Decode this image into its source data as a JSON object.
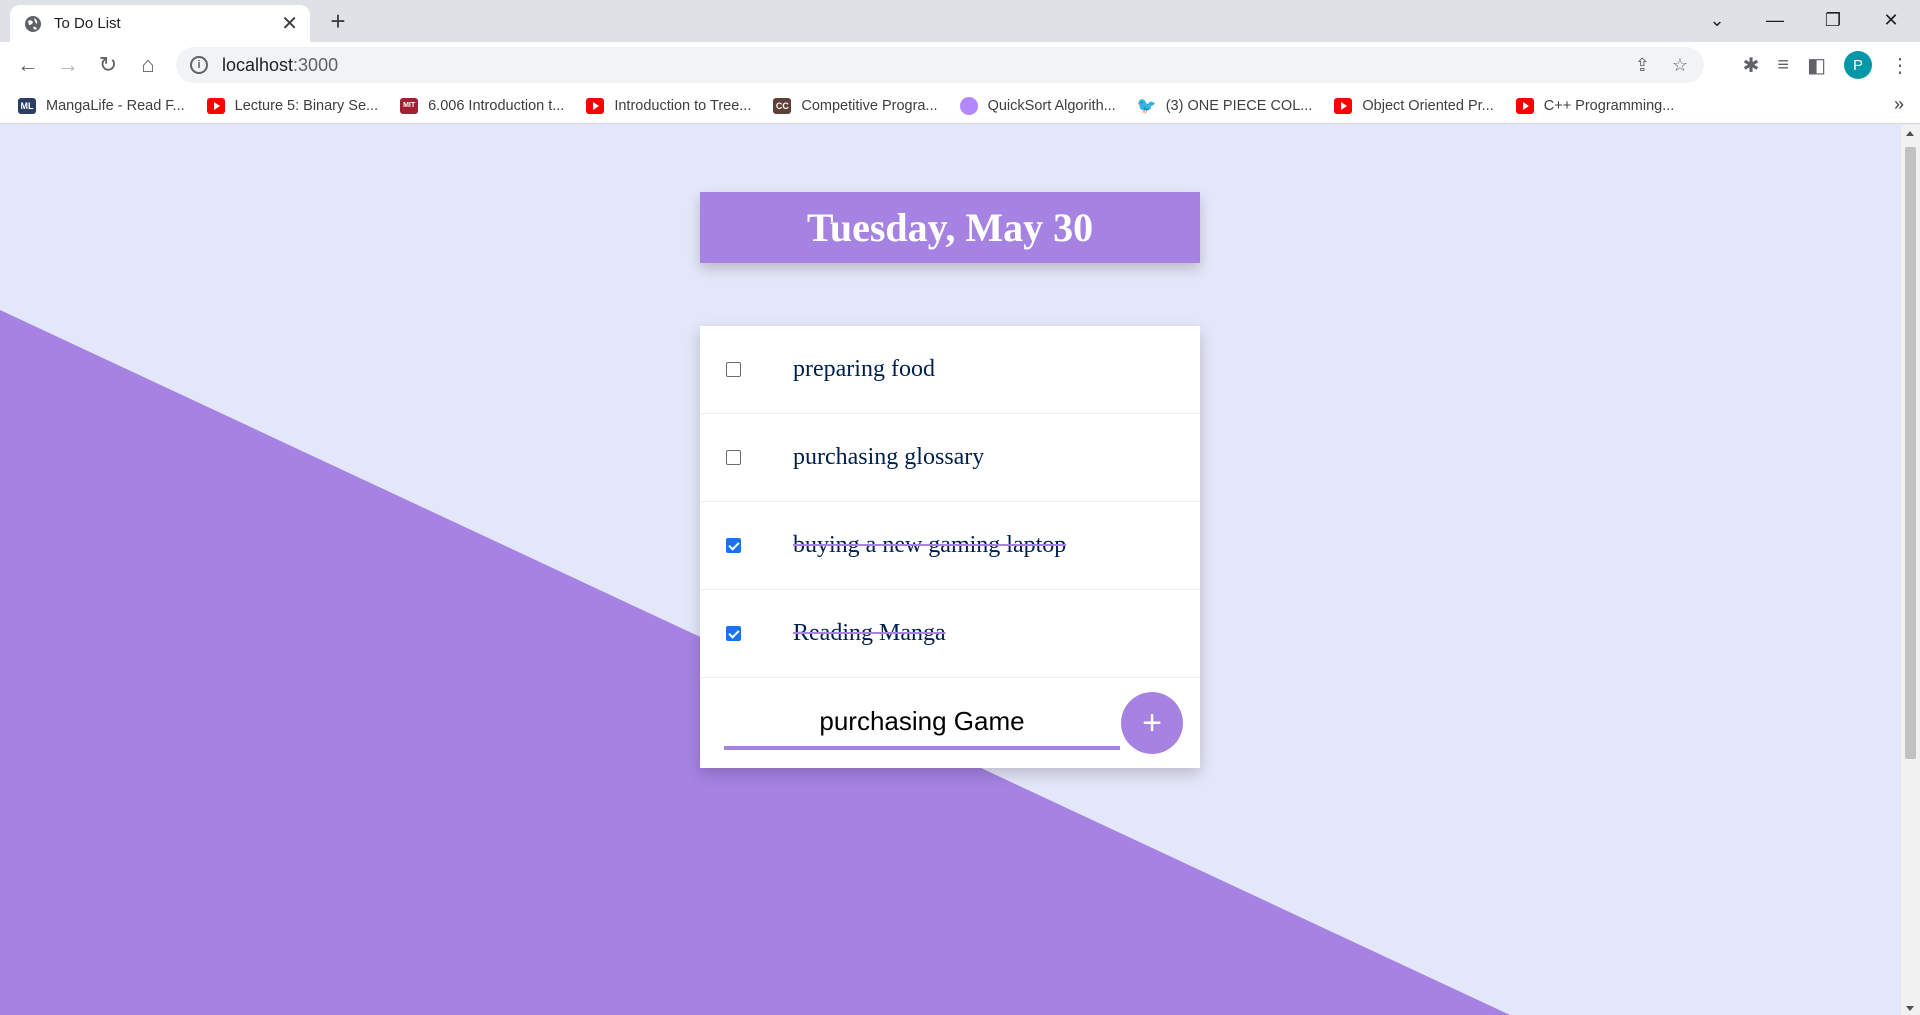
{
  "browser": {
    "tab_title": "To Do List",
    "url_host": "localhost",
    "url_port": ":3000",
    "avatar_letter": "P",
    "bookmarks": [
      {
        "label": "MangaLife - Read F...",
        "icon": "mangalife-icon"
      },
      {
        "label": "Lecture 5: Binary Se...",
        "icon": "youtube-icon"
      },
      {
        "label": "6.006 Introduction t...",
        "icon": "mit-ocw-icon"
      },
      {
        "label": "Introduction to Tree...",
        "icon": "youtube-icon"
      },
      {
        "label": "Competitive Progra...",
        "icon": "cc-icon"
      },
      {
        "label": "QuickSort Algorith...",
        "icon": "profile-pic-icon"
      },
      {
        "label": "(3) ONE PIECE COL...",
        "icon": "twitter-icon"
      },
      {
        "label": "Object Oriented Pr...",
        "icon": "youtube-icon"
      },
      {
        "label": "C++ Programming...",
        "icon": "youtube-icon"
      }
    ]
  },
  "page": {
    "heading": "Tuesday, May 30",
    "items": [
      {
        "text": "preparing food",
        "checked": false
      },
      {
        "text": "purchasing glossary",
        "checked": false
      },
      {
        "text": "buying a new gaming laptop",
        "checked": true
      },
      {
        "text": "Reading Manga",
        "checked": true
      }
    ],
    "new_item_value": "purchasing Game",
    "add_button_label": "+"
  },
  "colors": {
    "accent": "#a683e3",
    "background": "#e4e6f9",
    "text": "#00204a",
    "checkbox_checked": "#1a73e8"
  }
}
